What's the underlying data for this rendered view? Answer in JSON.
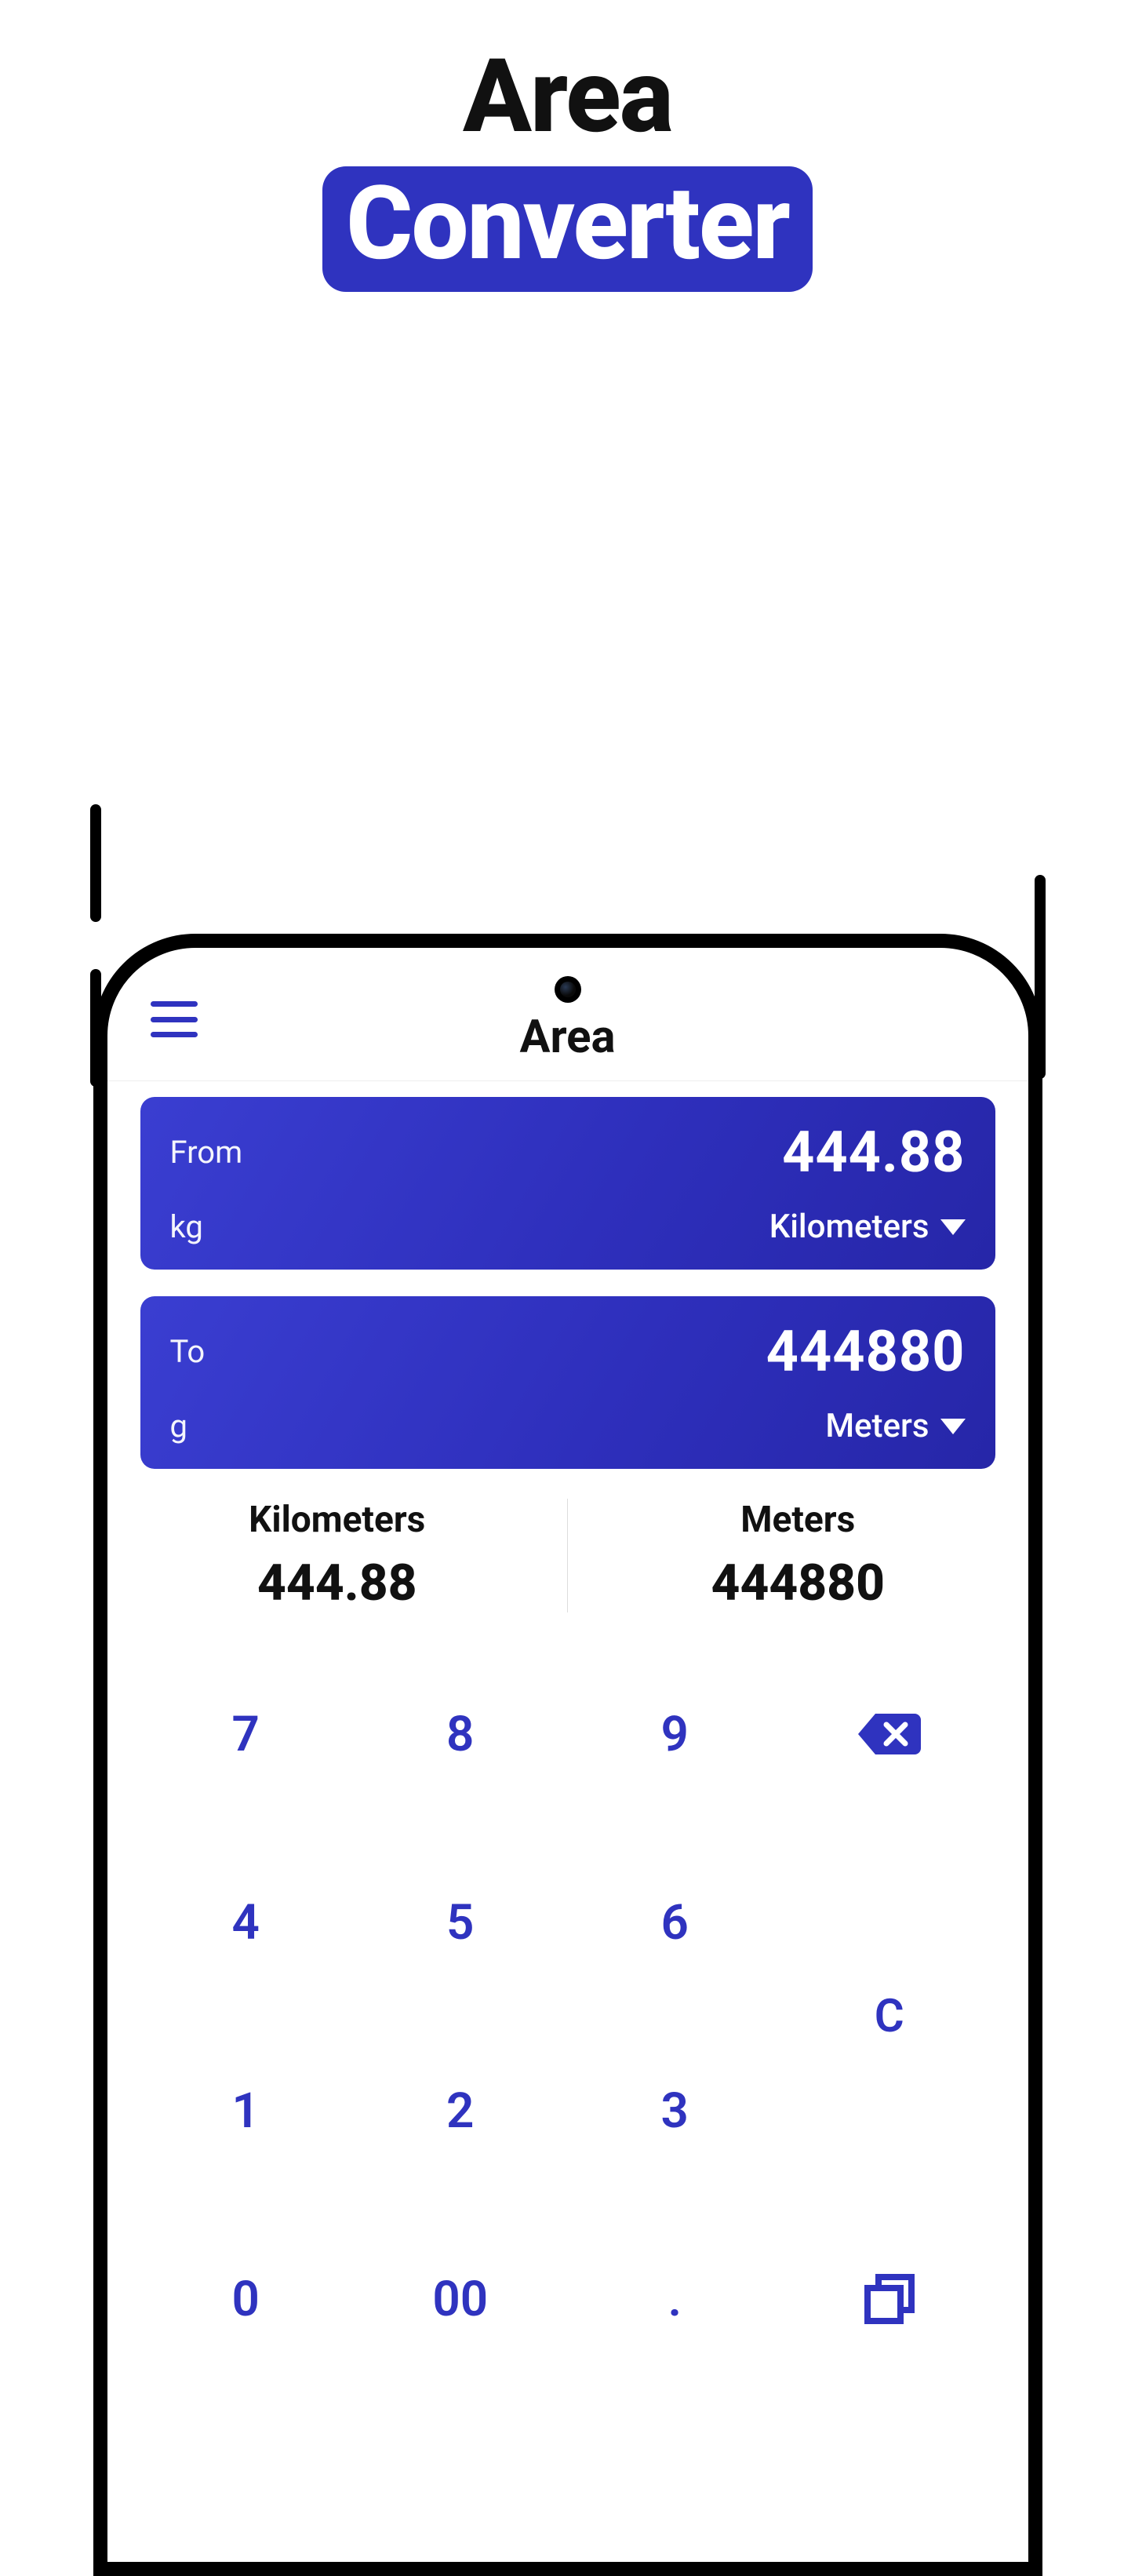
{
  "promo": {
    "line1": "Area",
    "line2": "Converter"
  },
  "header": {
    "title": "Area"
  },
  "from": {
    "label": "From",
    "abbr": "kg",
    "value": "444.88",
    "unit": "Kilometers"
  },
  "to": {
    "label": "To",
    "abbr": "g",
    "value": "444880",
    "unit": "Meters"
  },
  "summary": {
    "left_label": "Kilometers",
    "left_value": "444.88",
    "right_label": "Meters",
    "right_value": "444880"
  },
  "keypad": {
    "k7": "7",
    "k8": "8",
    "k9": "9",
    "k4": "4",
    "k5": "5",
    "k6": "6",
    "k1": "1",
    "k2": "2",
    "k3": "3",
    "k0": "0",
    "k00": "00",
    "kdot": ".",
    "clear": "C"
  },
  "colors": {
    "accent": "#2f33bf"
  }
}
